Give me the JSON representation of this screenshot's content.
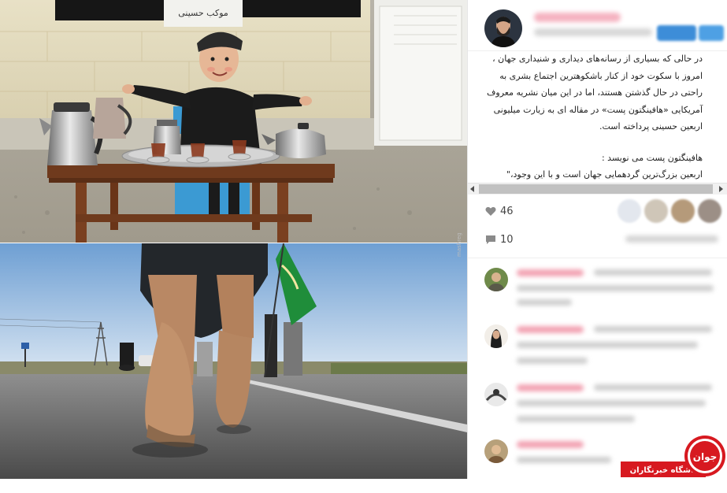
{
  "post": {
    "caption_lines": [
      "در حالی که بسیاری از رسانه‌های دیداری و شنیداری جهان ،",
      "امروز با سکوت خود از کنار باشکوهترین اجتماع بشری به",
      "راحتی در حال گذشتن هستند، اما در این میان نشریه معروف",
      "آمریکایی «هافینگتون پست» در مقاله ای به زیارت میلیونی",
      "اربعین حسینی پرداخته است."
    ],
    "caption_lines_2": [
      "هافینگتون پست می نویسد :",
      "اربعین بزرگ‌ترین گردهمایی جهان است و با این وجود،\""
    ]
  },
  "stats": {
    "likes": "46",
    "comments": "10"
  },
  "watermarks": {
    "photo_side": "mashreg",
    "badge_label": "باشگاه خبرنگاران",
    "badge_logo_text": "جوان"
  },
  "colors": {
    "accent_blue": "#3d8dd8",
    "username_pink": "#f3a5b5",
    "badge_red": "#d71920"
  },
  "icons": {
    "like": "heart-icon",
    "comment": "speech-bubble-icon",
    "scroll_left": "triangle-left-icon",
    "scroll_right": "triangle-right-icon"
  }
}
